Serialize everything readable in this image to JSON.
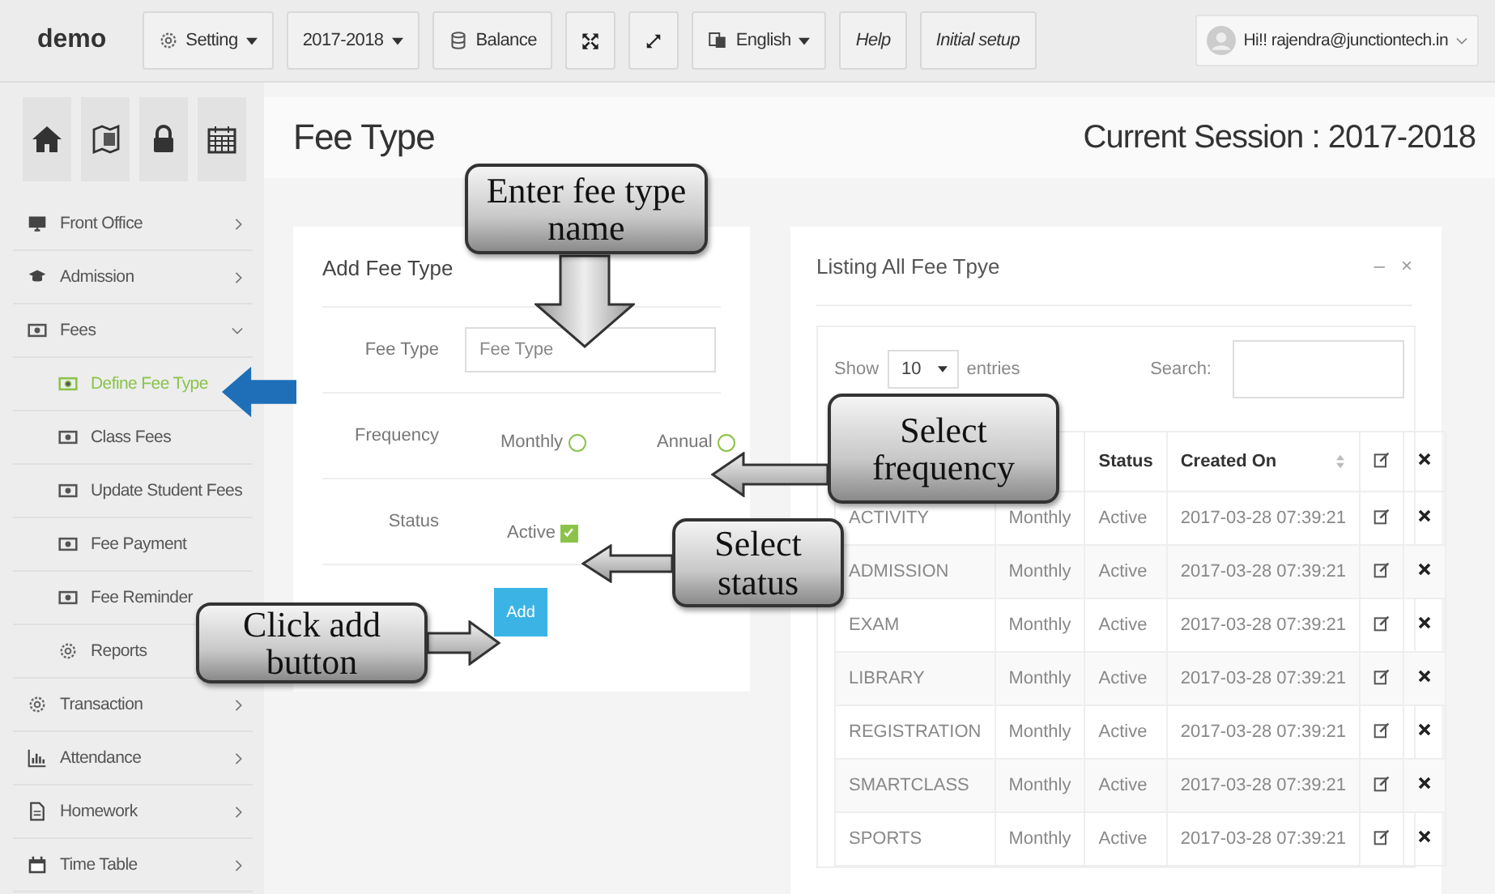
{
  "navbar": {
    "brand": "demo",
    "items": [
      {
        "label": "Setting",
        "kind": "menu"
      },
      {
        "label": "2017-2018",
        "kind": "menu"
      },
      {
        "label": "Balance",
        "kind": "button"
      },
      {
        "label": "English",
        "kind": "menu"
      },
      {
        "label": "Help",
        "kind": "link"
      },
      {
        "label": "Initial setup",
        "kind": "link"
      }
    ],
    "user": "Hi!! rajendra@junctiontech.in"
  },
  "sidebar": {
    "items": [
      {
        "label": "Front Office",
        "selected": false,
        "expanded": false
      },
      {
        "label": "Admission",
        "selected": false,
        "expanded": false
      },
      {
        "label": "Fees",
        "selected": false,
        "expanded": true,
        "children": [
          {
            "label": "Define Fee Type",
            "selected": true
          },
          {
            "label": "Class Fees",
            "selected": false
          },
          {
            "label": "Update Student Fees",
            "selected": false
          },
          {
            "label": "Fee Payment",
            "selected": false
          },
          {
            "label": "Fee Reminder",
            "selected": false
          },
          {
            "label": "Reports",
            "selected": false
          }
        ]
      },
      {
        "label": "Transaction",
        "selected": false,
        "expanded": false
      },
      {
        "label": "Attendance",
        "selected": false,
        "expanded": false
      },
      {
        "label": "Homework",
        "selected": false,
        "expanded": false
      },
      {
        "label": "Time Table",
        "selected": false,
        "expanded": false
      }
    ]
  },
  "page": {
    "title": "Fee Type",
    "session": "Current Session : 2017-2018"
  },
  "form": {
    "title": "Add Fee Type",
    "fee_type": {
      "label": "Fee Type",
      "placeholder": "Fee Type"
    },
    "frequency": {
      "label": "Frequency",
      "options": [
        {
          "label": "Monthly",
          "selected": false
        },
        {
          "label": "Annual",
          "selected": false
        }
      ]
    },
    "status": {
      "label": "Status",
      "option": "Active",
      "checked": true
    },
    "button": "Add"
  },
  "listing": {
    "title": "Listing All Fee Tpye",
    "controls": [
      "–",
      "×"
    ],
    "show_label": "Show",
    "page_size": "10",
    "entries_label": "entries",
    "search_label": "Search:",
    "columns": [
      "Status",
      "Created On"
    ],
    "rows": [
      {
        "name": "ACTIVITY",
        "frequency": "Monthly",
        "status": "Active",
        "created": "2017-03-28 07:39:21"
      },
      {
        "name": "ADMISSION",
        "frequency": "Monthly",
        "status": "Active",
        "created": "2017-03-28 07:39:21"
      },
      {
        "name": "EXAM",
        "frequency": "Monthly",
        "status": "Active",
        "created": "2017-03-28 07:39:21"
      },
      {
        "name": "LIBRARY",
        "frequency": "Monthly",
        "status": "Active",
        "created": "2017-03-28 07:39:21"
      },
      {
        "name": "REGISTRATION",
        "frequency": "Monthly",
        "status": "Active",
        "created": "2017-03-28 07:39:21"
      },
      {
        "name": "SMARTCLASS",
        "frequency": "Monthly",
        "status": "Active",
        "created": "2017-03-28 07:39:21"
      },
      {
        "name": "SPORTS",
        "frequency": "Monthly",
        "status": "Active",
        "created": "2017-03-28 07:39:21"
      }
    ]
  },
  "callouts": [
    {
      "text": "Enter fee type name"
    },
    {
      "text": "Select frequency"
    },
    {
      "text": "Select status"
    },
    {
      "text": "Click add button"
    }
  ]
}
